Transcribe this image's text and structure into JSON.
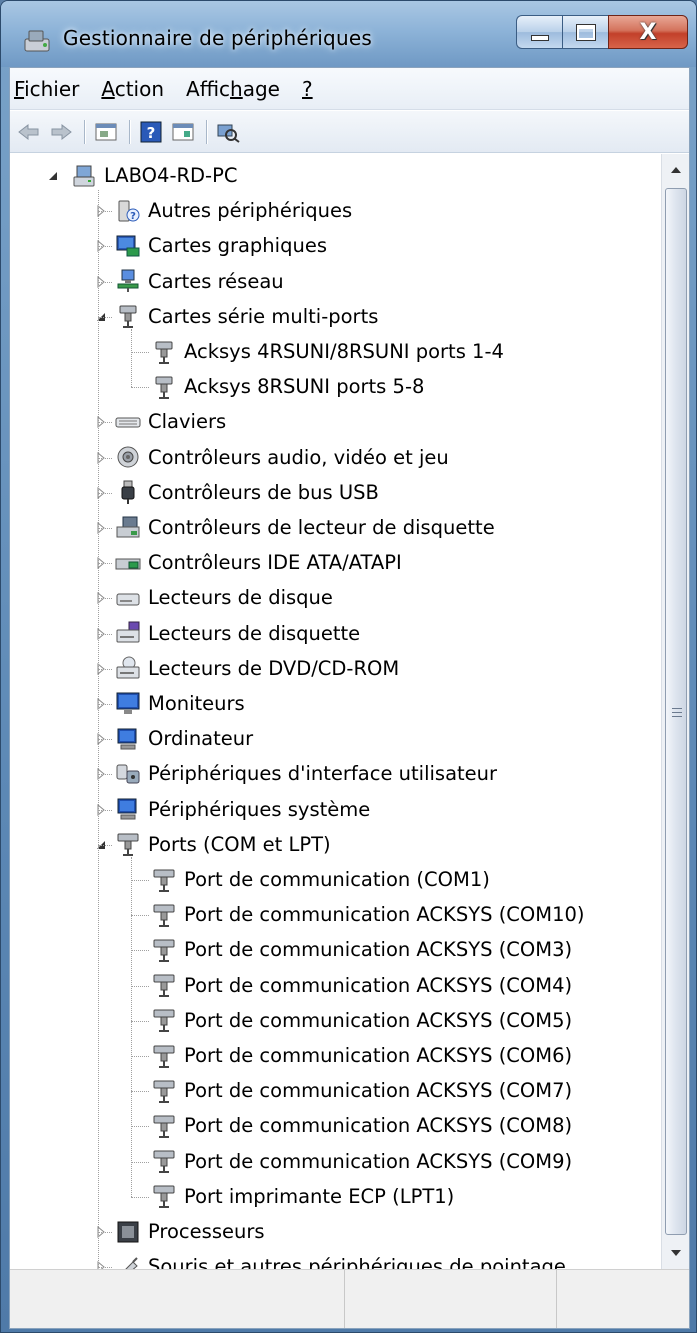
{
  "window": {
    "title": "Gestionnaire de périphériques",
    "close_glyph": "X"
  },
  "menu": [
    {
      "pre": "",
      "ul": "F",
      "post": "ichier"
    },
    {
      "pre": "",
      "ul": "A",
      "post": "ction"
    },
    {
      "pre": "Affic",
      "ul": "h",
      "post": "age"
    },
    {
      "pre": "",
      "ul": "?",
      "post": ""
    }
  ],
  "toolbar_icons": [
    "back-arrow-icon",
    "forward-arrow-icon",
    "properties-icon",
    "help-icon",
    "show-hidden-icon",
    "scan-hardware-icon"
  ],
  "tree": {
    "root": "LABO4-RD-PC",
    "items": [
      {
        "label": "Autres périphériques",
        "level": 1,
        "expander": "collapsed",
        "icon": "unknown-device-icon"
      },
      {
        "label": "Cartes graphiques",
        "level": 1,
        "expander": "collapsed",
        "icon": "display-adapter-icon"
      },
      {
        "label": "Cartes réseau",
        "level": 1,
        "expander": "collapsed",
        "icon": "network-adapter-icon"
      },
      {
        "label": "Cartes série multi-ports",
        "level": 1,
        "expander": "expanded",
        "icon": "multiport-serial-icon"
      },
      {
        "label": "Acksys 4RSUNI/8RSUNI ports 1-4",
        "level": 2,
        "expander": "none",
        "icon": "multiport-serial-icon"
      },
      {
        "label": "Acksys 8RSUNI ports 5-8",
        "level": 2,
        "expander": "none",
        "icon": "multiport-serial-icon"
      },
      {
        "label": "Claviers",
        "level": 1,
        "expander": "collapsed",
        "icon": "keyboard-icon"
      },
      {
        "label": "Contrôleurs audio, vidéo et jeu",
        "level": 1,
        "expander": "collapsed",
        "icon": "speaker-icon"
      },
      {
        "label": "Contrôleurs de bus USB",
        "level": 1,
        "expander": "collapsed",
        "icon": "usb-plug-icon"
      },
      {
        "label": "Contrôleurs de lecteur de disquette",
        "level": 1,
        "expander": "collapsed",
        "icon": "floppy-controller-icon"
      },
      {
        "label": "Contrôleurs IDE ATA/ATAPI",
        "level": 1,
        "expander": "collapsed",
        "icon": "ide-controller-icon"
      },
      {
        "label": "Lecteurs de disque",
        "level": 1,
        "expander": "collapsed",
        "icon": "disk-drive-icon"
      },
      {
        "label": "Lecteurs de disquette",
        "level": 1,
        "expander": "collapsed",
        "icon": "floppy-drive-icon"
      },
      {
        "label": "Lecteurs de DVD/CD-ROM",
        "level": 1,
        "expander": "collapsed",
        "icon": "dvd-drive-icon"
      },
      {
        "label": "Moniteurs",
        "level": 1,
        "expander": "collapsed",
        "icon": "monitor-icon"
      },
      {
        "label": "Ordinateur",
        "level": 1,
        "expander": "collapsed",
        "icon": "computer-icon"
      },
      {
        "label": "Périphériques d'interface utilisateur",
        "level": 1,
        "expander": "collapsed",
        "icon": "hid-device-icon"
      },
      {
        "label": "Périphériques système",
        "level": 1,
        "expander": "collapsed",
        "icon": "system-device-icon"
      },
      {
        "label": "Ports (COM et LPT)",
        "level": 1,
        "expander": "expanded",
        "icon": "port-connector-icon"
      },
      {
        "label": "Port de communication (COM1)",
        "level": 2,
        "expander": "none",
        "icon": "port-connector-icon"
      },
      {
        "label": "Port de communication ACKSYS (COM10)",
        "level": 2,
        "expander": "none",
        "icon": "port-connector-icon"
      },
      {
        "label": "Port de communication ACKSYS (COM3)",
        "level": 2,
        "expander": "none",
        "icon": "port-connector-icon"
      },
      {
        "label": "Port de communication ACKSYS (COM4)",
        "level": 2,
        "expander": "none",
        "icon": "port-connector-icon"
      },
      {
        "label": "Port de communication ACKSYS (COM5)",
        "level": 2,
        "expander": "none",
        "icon": "port-connector-icon"
      },
      {
        "label": "Port de communication ACKSYS (COM6)",
        "level": 2,
        "expander": "none",
        "icon": "port-connector-icon"
      },
      {
        "label": "Port de communication ACKSYS (COM7)",
        "level": 2,
        "expander": "none",
        "icon": "port-connector-icon"
      },
      {
        "label": "Port de communication ACKSYS (COM8)",
        "level": 2,
        "expander": "none",
        "icon": "port-connector-icon"
      },
      {
        "label": "Port de communication ACKSYS (COM9)",
        "level": 2,
        "expander": "none",
        "icon": "port-connector-icon"
      },
      {
        "label": "Port imprimante ECP (LPT1)",
        "level": 2,
        "expander": "none",
        "icon": "port-connector-icon"
      },
      {
        "label": "Processeurs",
        "level": 1,
        "expander": "collapsed",
        "icon": "processor-icon"
      },
      {
        "label": "Souris et autres périphériques de pointage",
        "level": 1,
        "expander": "collapsed",
        "icon": "mouse-icon"
      }
    ]
  },
  "scrollbar": {
    "up_icon": "scroll-up-arrow-icon",
    "down_icon": "scroll-down-arrow-icon"
  },
  "statusbar": {
    "panes": [
      "",
      "",
      ""
    ]
  }
}
